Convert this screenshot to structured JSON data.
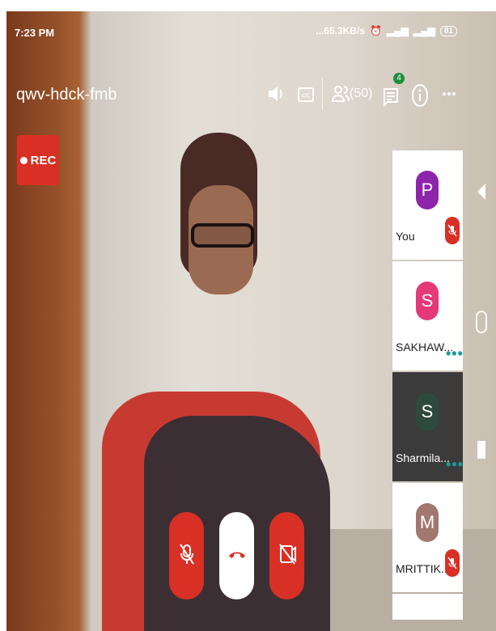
{
  "status_bar": {
    "time": "7:23 PM",
    "network_speed": "...65.3KB/s",
    "battery": "81"
  },
  "meeting": {
    "code": "qwv-hdck-fmb",
    "rec_label": "REC",
    "participants_count": "(50)",
    "chat_badge": "4"
  },
  "participants": [
    {
      "initial": "P",
      "name": "You",
      "color": "#8e24aa",
      "mic_muted": true,
      "selected": false
    },
    {
      "initial": "S",
      "name": "SAKHAW...",
      "color": "#e53978",
      "mic_muted": false,
      "selected": false
    },
    {
      "initial": "S",
      "name": "Sharmila...",
      "color": "#2e4a3e",
      "mic_muted": false,
      "selected": true
    },
    {
      "initial": "M",
      "name": "MRITTIK...",
      "color": "#a1776e",
      "mic_muted": true,
      "selected": false
    }
  ],
  "icons": {
    "volume": "speaker-icon",
    "captions": "closed-captions-icon",
    "people": "people-icon",
    "chat": "chat-icon",
    "info": "info-icon",
    "more": "more-icon",
    "mic_off": "mic-off-icon",
    "end_call": "end-call-icon",
    "camera_off": "camera-off-icon"
  },
  "colors": {
    "accent_red": "#d93025",
    "badge_green": "#1e8e3e",
    "tile_bg": "#ffffff",
    "tile_selected_bg": "#3b3b3b"
  }
}
